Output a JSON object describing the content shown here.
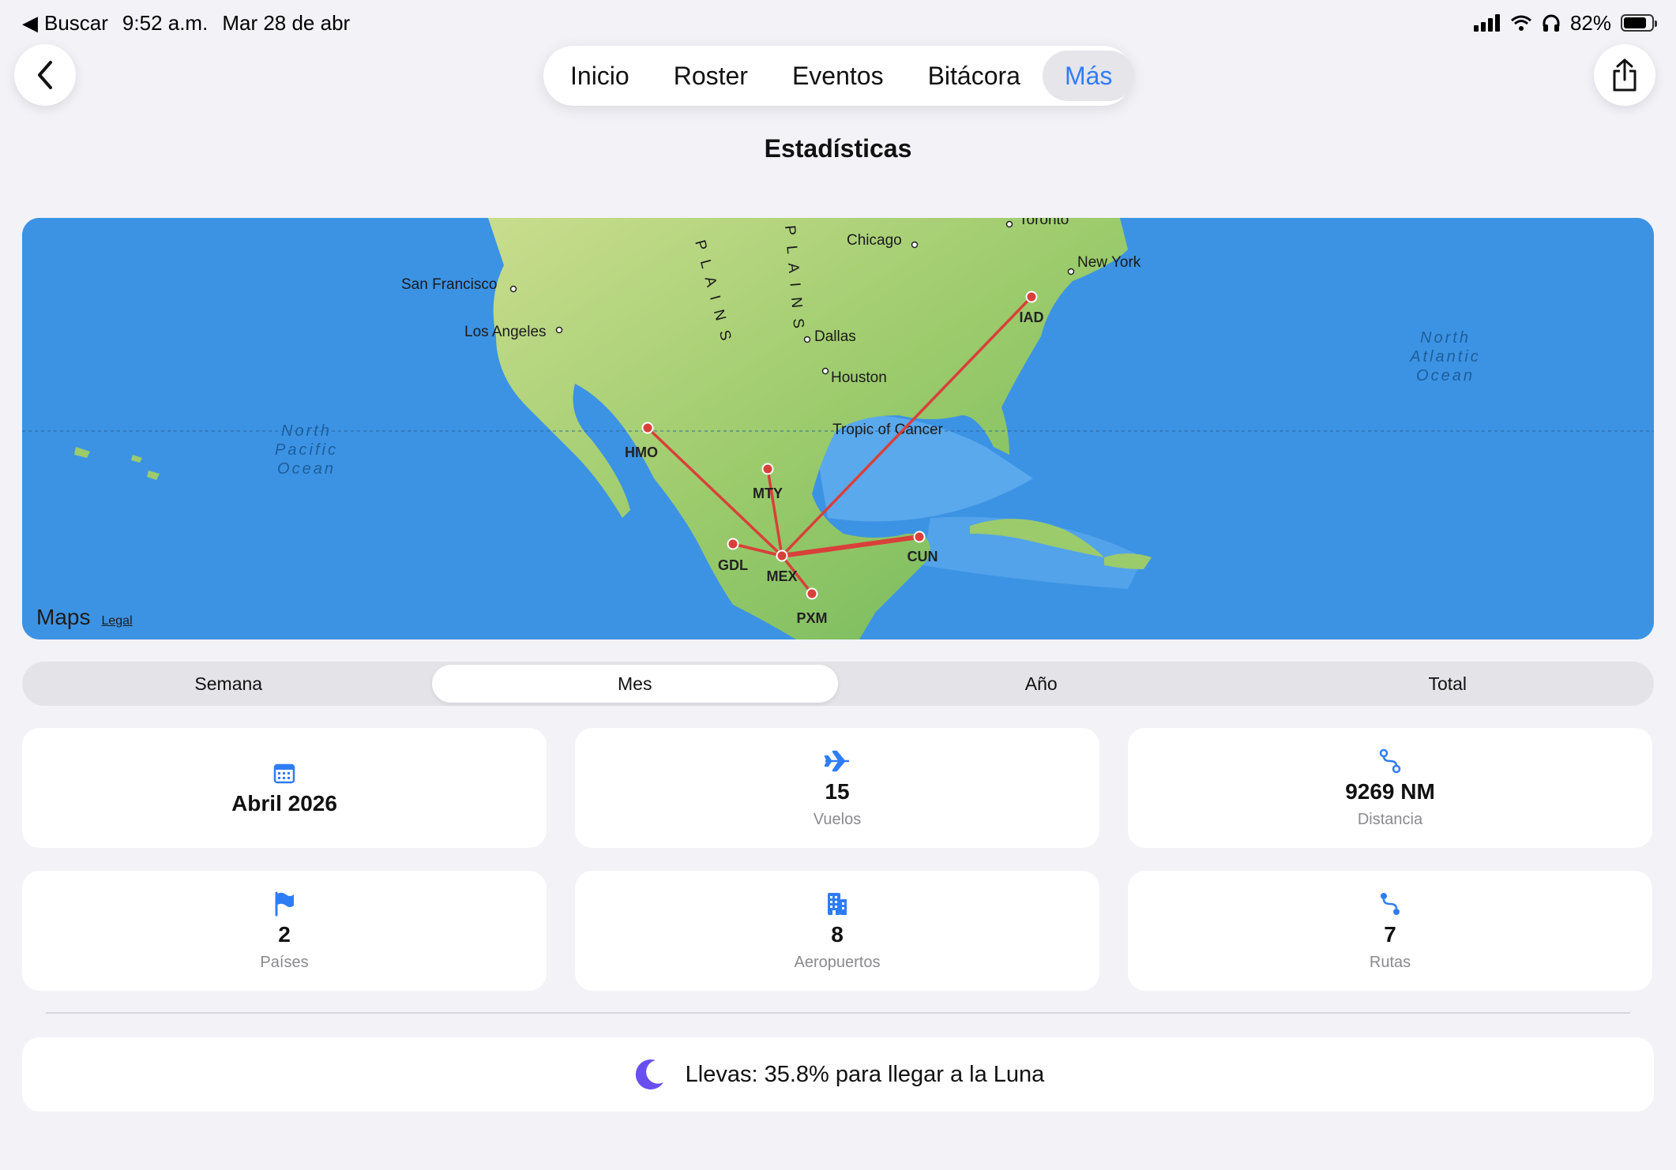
{
  "status_bar": {
    "back_app": "Buscar",
    "time": "9:52 a.m.",
    "date": "Mar 28 de abr",
    "battery": "82%",
    "battery_level": 0.82
  },
  "nav": {
    "tabs": [
      {
        "label": "Inicio",
        "active": false
      },
      {
        "label": "Roster",
        "active": false
      },
      {
        "label": "Eventos",
        "active": false
      },
      {
        "label": "Bitácora",
        "active": false
      },
      {
        "label": "Más",
        "active": true
      }
    ]
  },
  "page_title": "Estadísticas",
  "map": {
    "cities": [
      "Toronto",
      "Chicago",
      "New York",
      "San Francisco",
      "Los Angeles",
      "Dallas",
      "Houston"
    ],
    "oceans": {
      "pacific": [
        "North",
        "Pacific",
        "Ocean"
      ],
      "atlantic": [
        "North",
        "Atlantic",
        "Ocean"
      ]
    },
    "features": {
      "tropic": "Tropic of Cancer",
      "plains_left": "P L A I N S",
      "plains_right": "P L A I N S"
    },
    "airports": [
      "HMO",
      "MTY",
      "GDL",
      "MEX",
      "PXM",
      "CUN",
      "IAD"
    ],
    "routes": [
      [
        "MEX",
        "HMO"
      ],
      [
        "MEX",
        "MTY"
      ],
      [
        "MEX",
        "GDL"
      ],
      [
        "MEX",
        "PXM"
      ],
      [
        "MEX",
        "CUN"
      ],
      [
        "MEX",
        "IAD"
      ],
      [
        "GDL",
        "MEX"
      ]
    ],
    "brand": "Maps",
    "legal": "Legal",
    "route_color": "#d9403a"
  },
  "period_selector": {
    "options": [
      "Semana",
      "Mes",
      "Año",
      "Total"
    ],
    "selected": "Mes"
  },
  "stats": {
    "period": {
      "value": "Abril 2026",
      "icon": "calendar-icon"
    },
    "flights": {
      "value": "15",
      "label": "Vuelos",
      "icon": "airplane-icon"
    },
    "distance": {
      "value": "9269 NM",
      "label": "Distancia",
      "icon": "route-icon"
    },
    "countries": {
      "value": "2",
      "label": "Países",
      "icon": "flag-icon"
    },
    "airports": {
      "value": "8",
      "label": "Aeropuertos",
      "icon": "building-icon"
    },
    "routes": {
      "value": "7",
      "label": "Rutas",
      "icon": "route-icon"
    }
  },
  "moon": {
    "text": "Llevas: 35.8% para llegar a la Luna",
    "icon": "moon-icon"
  },
  "colors": {
    "accent": "#2f7df6",
    "moon": "#6a4ff0"
  }
}
